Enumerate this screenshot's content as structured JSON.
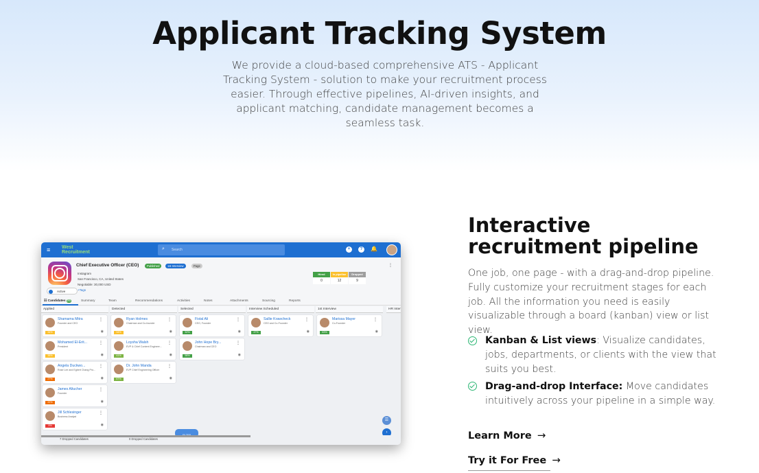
{
  "hero": {
    "title": "Applicant Tracking System",
    "description": "We provide a cloud-based comprehensive ATS - Applicant Tracking System - solution to make your recruitment process easier. Through effective pipelines, AI-driven insights, and applicant matching, candidate management becomes a seamless task."
  },
  "app": {
    "logo": "West Recruitment",
    "search_placeholder": "Search",
    "job": {
      "title": "Chief Executive Officer (CEO)",
      "badges": [
        "Published",
        "1st Interview",
        "Page"
      ],
      "company": "Instagram",
      "location": "San Francisco, CA, United States",
      "salary": "Negotiable: 30,000 USD",
      "tags": "+Tags",
      "status": "Active"
    },
    "stats": [
      {
        "label": "Hired",
        "value": "0",
        "color": "#43a047"
      },
      {
        "label": "In pipeline",
        "value": "12",
        "color": "#fbc02d"
      },
      {
        "label": "Dropped",
        "value": "9",
        "color": "#9e9e9e"
      }
    ],
    "tabs": [
      "Candidates",
      "Summary",
      "Team",
      "Recommendations",
      "Activities",
      "Notes",
      "Attachments",
      "Sourcing",
      "Reports"
    ],
    "tab_count": "21",
    "columns": [
      {
        "name": "Applied",
        "cards": [
          {
            "name": "Shamama Mitra",
            "sub": "Founder and CEO",
            "pct": "34%",
            "color": "#fbc02d"
          },
          {
            "name": "Mohamed El-Erit...",
            "sub": "President",
            "pct": "38%",
            "color": "#fbc02d"
          },
          {
            "name": "Angela Duckwo...",
            "sub": "Rose Lee and Egbert Chang Pro...",
            "pct": "27%",
            "color": "#ef6c00"
          },
          {
            "name": "James Altucher",
            "sub": "Founder",
            "pct": "22%",
            "color": "#ef6c00"
          },
          {
            "name": "Jill Schlesinger",
            "sub": "Business Analyst",
            "pct": "9%",
            "color": "#e53935"
          }
        ]
      },
      {
        "name": "Detected",
        "cards": [
          {
            "name": "Ryan Holmes",
            "sub": "Chairman and Co-founder",
            "pct": "34%",
            "color": "#fbc02d"
          },
          {
            "name": "Loysha Walsh",
            "sub": "EVP & Chief Content Engineer...",
            "pct": "41%",
            "color": "#7cb342"
          },
          {
            "name": "Dr. John Manda",
            "sub": "EVP Chief Engineering Officer",
            "pct": "67%",
            "color": "#7cb342"
          }
        ]
      },
      {
        "name": "Selected",
        "cards": [
          {
            "name": "Fistal Ali",
            "sub": "CEO, Founder",
            "pct": "32%",
            "color": "#43a047"
          },
          {
            "name": "John Hope Bry...",
            "sub": "Chairman and CEO",
            "pct": "98%",
            "color": "#43a047"
          }
        ]
      },
      {
        "name": "Interview Scheduled",
        "cards": [
          {
            "name": "Sallie Krawcheck",
            "sub": "CEO and Co-Founder",
            "pct": "47%",
            "color": "#43a047"
          }
        ]
      },
      {
        "name": "1st Interview",
        "cards": [
          {
            "name": "Marissa Mayer",
            "sub": "Co-Founder",
            "pct": "63%",
            "color": "#43a047"
          }
        ]
      },
      {
        "name": "HR Interv",
        "cards": []
      }
    ],
    "footer": [
      "7 Dropped Candidates",
      "0 Dropped Candidates"
    ],
    "filter_label": "FILTER"
  },
  "feature": {
    "title": "Interactive recruitment pipeline",
    "description": "One job, one page - with a drag-and-drop pipeline. Fully customize your recruitment stages for each job. All the information you need is easily visualizable through a board (kanban) view or list view.",
    "bullets": [
      {
        "bold": "Kanban & List views",
        "text": ": Visualize candidates, jobs, departments, or clients with the view that suits you best."
      },
      {
        "bold": "Drag-and-drop Interface:",
        "text": " Move candidates intuitively across your pipeline in a simple way."
      }
    ],
    "learn_more": "Learn More",
    "try_free": "Try it For Free"
  }
}
